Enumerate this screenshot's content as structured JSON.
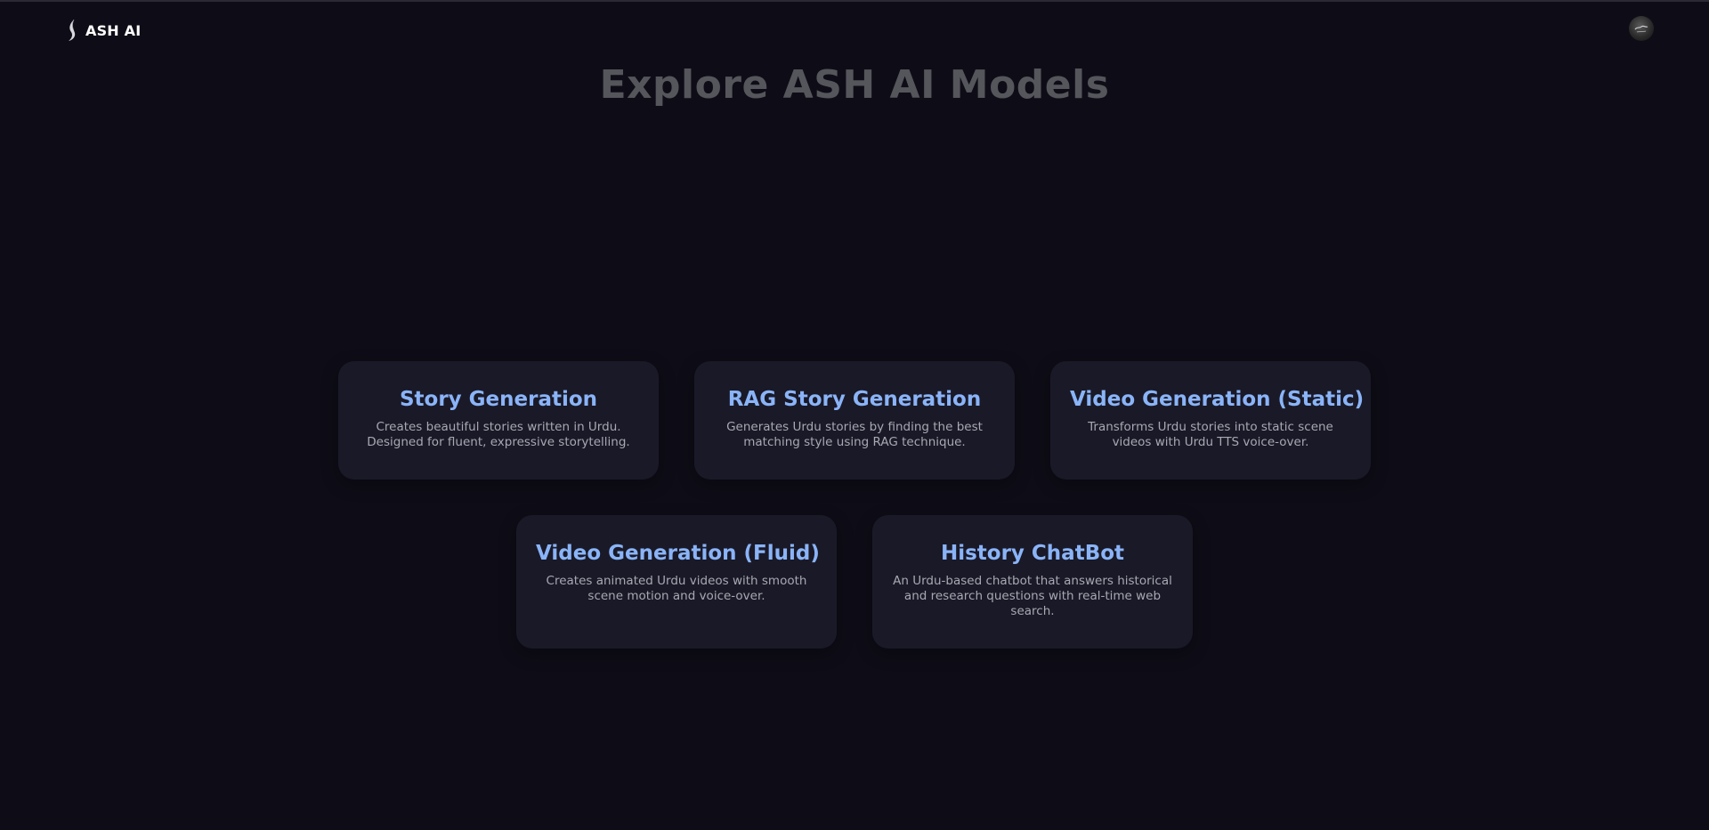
{
  "navbar": {
    "brand_name": "ASH AI",
    "logo_icon": "sparkle-logo-icon",
    "avatar_icon": "user-avatar-icon"
  },
  "main": {
    "title": "Explore ASH AI Models"
  },
  "models": [
    {
      "title": "Story Generation",
      "description": "Creates beautiful stories written in Urdu. Designed for fluent, expressive storytelling."
    },
    {
      "title": "RAG Story Generation",
      "description": "Generates Urdu stories by finding the best matching style using RAG technique."
    },
    {
      "title": "Video Generation (Static)",
      "description": "Transforms Urdu stories into static scene videos with Urdu TTS voice-over."
    },
    {
      "title": "Video Generation (Fluid)",
      "description": "Creates animated Urdu videos with smooth scene motion and voice-over."
    },
    {
      "title": "History ChatBot",
      "description": "An Urdu-based chatbot that answers historical and research questions with real-time web search."
    }
  ],
  "colors": {
    "background": "#0e0d17",
    "card_background": "#1a1927",
    "card_title": "#8ab4f8",
    "card_text": "#a8a8b3",
    "page_title": "#55555c"
  }
}
